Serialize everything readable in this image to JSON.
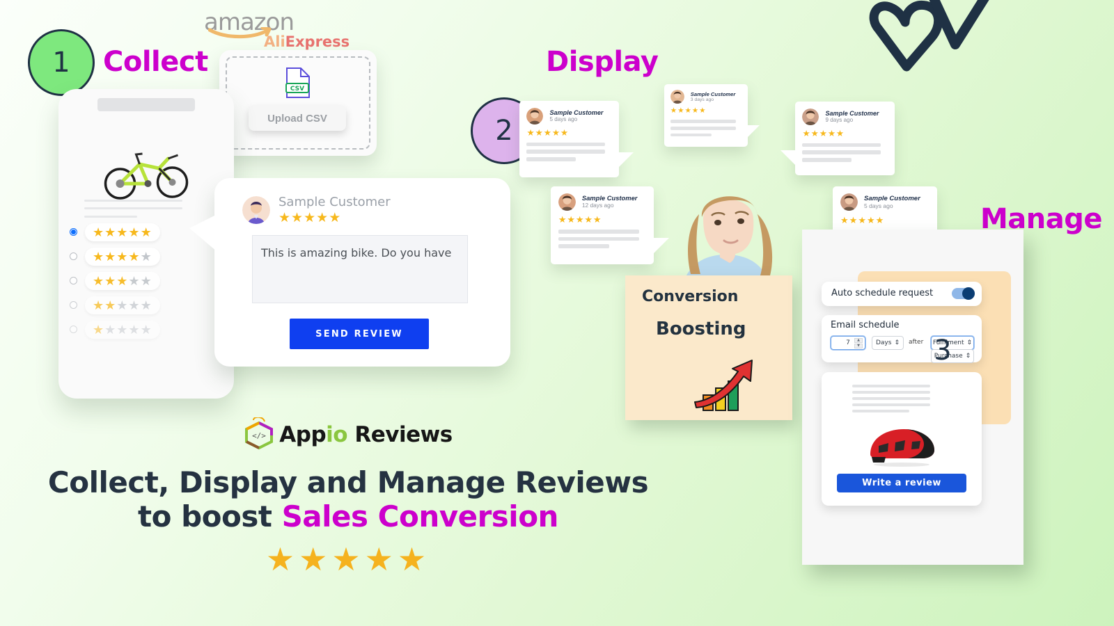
{
  "background": {
    "from": "#fbfffa",
    "to": "#cdf3bd"
  },
  "theme": {
    "accent_magenta": "#cc00cc",
    "dark_navy": "#1f3144",
    "badge_green": "#7ee87e",
    "badge_purple": "#ddb3ec",
    "primary_blue": "#0f3ff0",
    "star_gold": "#f7b81c"
  },
  "steps": [
    {
      "number": "1",
      "label": "Collect",
      "color": "#7ee87e"
    },
    {
      "number": "2",
      "label": "Display",
      "color": "#ddb3ec"
    },
    {
      "number": "3",
      "label": "Manage",
      "color": "#7ee87e"
    }
  ],
  "collect": {
    "marketplaces": {
      "amazon": "amazon",
      "aliexpress": "AliExpress"
    },
    "upload": {
      "file_type_badge": "CSV",
      "button_label": "Upload CSV"
    },
    "product_card": {
      "product_image_alt": "green mountain bike",
      "rating_options": [
        {
          "stars": 5,
          "selected": true
        },
        {
          "stars": 4,
          "selected": false
        },
        {
          "stars": 3,
          "selected": false
        },
        {
          "stars": 2,
          "selected": false
        },
        {
          "stars": 1,
          "selected": false
        }
      ]
    },
    "review_form": {
      "customer_name": "Sample Customer",
      "rating": 5,
      "review_text": "This is amazing bike. Do you have",
      "submit_label": "SEND REVIEW"
    }
  },
  "display": {
    "reviews": [
      {
        "name": "Sample Customer",
        "ago": "5 days ago",
        "rating": 5
      },
      {
        "name": "Sample Customer",
        "ago": "3 days ago",
        "rating": 5
      },
      {
        "name": "Sample Customer",
        "ago": "9 days ago",
        "rating": 5
      },
      {
        "name": "Sample Customer",
        "ago": "12 days ago",
        "rating": 5
      },
      {
        "name": "Sample Customer",
        "ago": "5 days ago",
        "rating": 5
      }
    ],
    "persona_alt": "woman thinking"
  },
  "conversion_card": {
    "line1": "Conversion",
    "line2": "Boosting",
    "icon": "growth-chart-arrow"
  },
  "manage": {
    "auto_schedule": {
      "label": "Auto schedule request",
      "enabled": true
    },
    "email_schedule": {
      "label": "Email schedule",
      "amount": "7",
      "unit": "Days",
      "conjunction": "after",
      "event": "Fulfilment",
      "event_alt": "Purchase"
    },
    "product_review": {
      "product_image_alt": "red cycling helmet",
      "button_label": "Write a review"
    }
  },
  "footer": {
    "logo": {
      "prefix": "App",
      "accent": "io",
      "suffix": " Reviews"
    },
    "headline_line1": "Collect, Display and Manage Reviews",
    "headline_line2_prefix": "to boost ",
    "headline_line2_accent": "Sales Conversion",
    "stars": "★★★★★"
  }
}
